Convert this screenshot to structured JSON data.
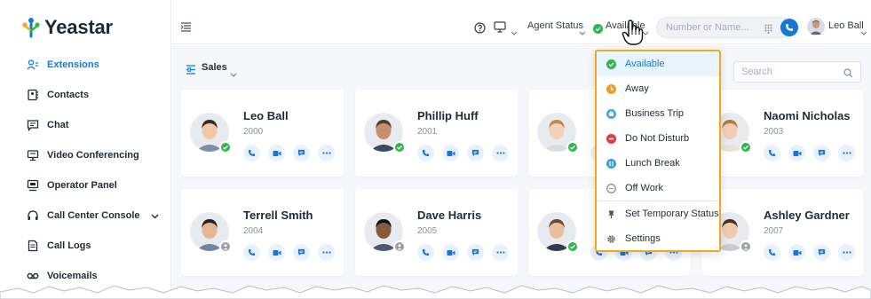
{
  "app": {
    "logo_text": "Yeastar"
  },
  "sidebar": {
    "items": [
      {
        "label": "Extensions",
        "icon": "extensions-icon"
      },
      {
        "label": "Contacts",
        "icon": "contacts-icon"
      },
      {
        "label": "Chat",
        "icon": "chat-icon"
      },
      {
        "label": "Video Conferencing",
        "icon": "video-conferencing-icon"
      },
      {
        "label": "Operator Panel",
        "icon": "operator-panel-icon"
      },
      {
        "label": "Call Center Console",
        "icon": "headset-icon"
      },
      {
        "label": "Call Logs",
        "icon": "call-logs-icon"
      },
      {
        "label": "Voicemails",
        "icon": "voicemail-icon"
      }
    ]
  },
  "header": {
    "agent_status_label": "Agent Status",
    "presence_label": "Available",
    "dial_placeholder": "Number or Name...",
    "user_name": "Leo Ball"
  },
  "main": {
    "group_label": "Sales",
    "search_placeholder": "Search",
    "cards": [
      {
        "name": "Leo Ball",
        "ext": "2000",
        "status": "online"
      },
      {
        "name": "Phillip Huff",
        "ext": "2001",
        "status": "online"
      },
      {
        "name": "",
        "ext": "",
        "status": "online"
      },
      {
        "name": "Naomi Nicholas",
        "ext": "2003",
        "status": "online"
      },
      {
        "name": "Terrell Smith",
        "ext": "2004",
        "status": "offline"
      },
      {
        "name": "Dave Harris",
        "ext": "2005",
        "status": "offline"
      },
      {
        "name": "",
        "ext": "",
        "status": "online"
      },
      {
        "name": "Ashley Gardner",
        "ext": "2007",
        "status": "offline"
      }
    ]
  },
  "status_menu": {
    "items": [
      {
        "label": "Available",
        "color": "#2eb84b"
      },
      {
        "label": "Away",
        "color": "#f59a23"
      },
      {
        "label": "Business Trip",
        "color": "#3aa5e8"
      },
      {
        "label": "Do Not Disturb",
        "color": "#e8383d"
      },
      {
        "label": "Lunch Break",
        "color": "#2f9ee8"
      },
      {
        "label": "Off Work",
        "color": "#8a939e"
      },
      {
        "label": "Set Temporary Status",
        "color": "#4a5563"
      },
      {
        "label": "Settings",
        "color": "#4a5563"
      }
    ]
  },
  "colors": {
    "accent": "#1677d8",
    "highlight_border": "#f2a81e",
    "online": "#2eb84b",
    "offline": "#9aa0a8"
  }
}
